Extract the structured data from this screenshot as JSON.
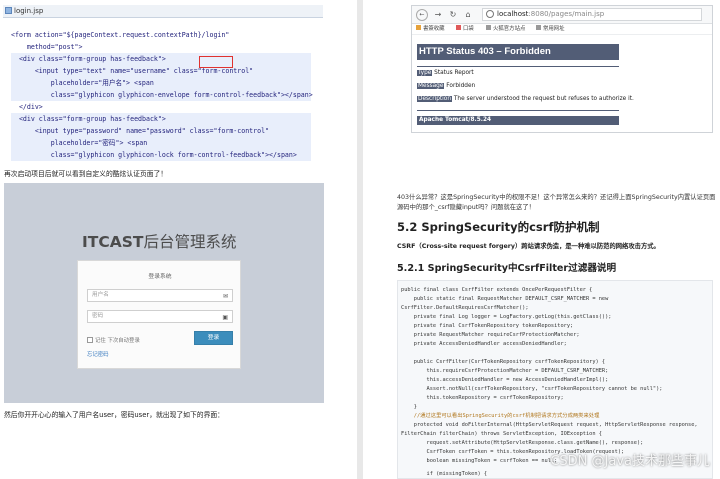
{
  "left": {
    "file_tab": "login.jsp",
    "code_lines": [
      "<form action=\"${pageContext.request.contextPath}/login\"",
      "    method=\"post\">",
      "  <div class=\"form-group has-feedback\">",
      "      <input type=\"text\" name=\"username\" class=\"form-control\"",
      "          placeholder=\"用户名\"> <span",
      "          class=\"glyphicon glyphicon-envelope form-control-feedback\"></span>",
      "  </div>",
      "  <div class=\"form-group has-feedback\">",
      "      <input type=\"password\" name=\"password\" class=\"form-control\"",
      "          placeholder=\"密码\"> <span",
      "          class=\"glyphicon glyphicon-lock form-control-feedback\"></span>"
    ],
    "caption_top": "再次启动项目后就可以看到自定义的酷炫认证页面了！",
    "brand_bold": "ITCAST",
    "brand_rest": "后台管理系统",
    "login_card_title": "登录系统",
    "username_placeholder": "用户名",
    "password_placeholder": "密码",
    "remember_label": "记住 下次自动登录",
    "forgot_label": "忘记密码",
    "login_button": "登录",
    "caption_bottom": "然后你开开心心的输入了用户名user，密码user，就出现了如下的界面："
  },
  "right": {
    "url_host": "localhost",
    "url_path": ":8080/pages/main.jsp",
    "bookmarks": [
      "書簽收藏",
      "口袋",
      "火狐官方站点",
      "常用网址"
    ],
    "http_status_title": "HTTP Status 403 – Forbidden",
    "error_rows": [
      {
        "key": "Type",
        "value": "Status Report"
      },
      {
        "key": "Message",
        "value": "Forbidden"
      },
      {
        "key": "Description",
        "value": "The server understood the request but refuses to authorize it."
      }
    ],
    "tomcat_version": "Apache Tomcat/8.5.24",
    "paragraph_1": "403什么异常？这是SpringSecurity中的权限不足！这个异常怎么来的？还记得上面SpringSecurity内置认证页面源码中的那个_csrf隐藏input吗？问题就在这了！",
    "heading_52": "5.2 SpringSecurity的csrf防护机制",
    "paragraph_2": "CSRF（Cross-site request forgery）跨站请求伪造，是一种难以防范的网络攻击方式。",
    "heading_521": "5.2.1 SpringSecurity中CsrfFilter过滤器说明",
    "code_lines": [
      "public final class CsrfFilter extends OncePerRequestFilter {",
      "    public static final RequestMatcher DEFAULT_CSRF_MATCHER = new",
      "CsrfFilter.DefaultRequiresCsrfMatcher();",
      "    private final Log logger = LogFactory.getLog(this.getClass());",
      "    private final CsrfTokenRepository tokenRepository;",
      "    private RequestMatcher requireCsrfProtectionMatcher;",
      "    private AccessDeniedHandler accessDeniedHandler;",
      "",
      "    public CsrfFilter(CsrfTokenRepository csrfTokenRepository) {",
      "        this.requireCsrfProtectionMatcher = DEFAULT_CSRF_MATCHER;",
      "        this.accessDeniedHandler = new AccessDeniedHandlerImpl();",
      "        Assert.notNull(csrfTokenRepository, \"csrfTokenRepository cannot be null\");",
      "        this.tokenRepository = csrfTokenRepository;",
      "    }",
      "    //通过这里可以看出SpringSecurity的csrf机制把请求方式分成两类来处理",
      "    protected void doFilterInternal(HttpServletRequest request, HttpServletResponse response,",
      "FilterChain filterChain) throws ServletException, IOException {",
      "        request.setAttribute(HttpServletResponse.class.getName(), response);",
      "        CsrfToken csrfToken = this.tokenRepository.loadToken(request);",
      "        boolean missingToken = csrfToken == null;",
      "",
      "        if (missingToken) {"
    ],
    "watermark": "CSDN @Java技术那些事儿"
  }
}
